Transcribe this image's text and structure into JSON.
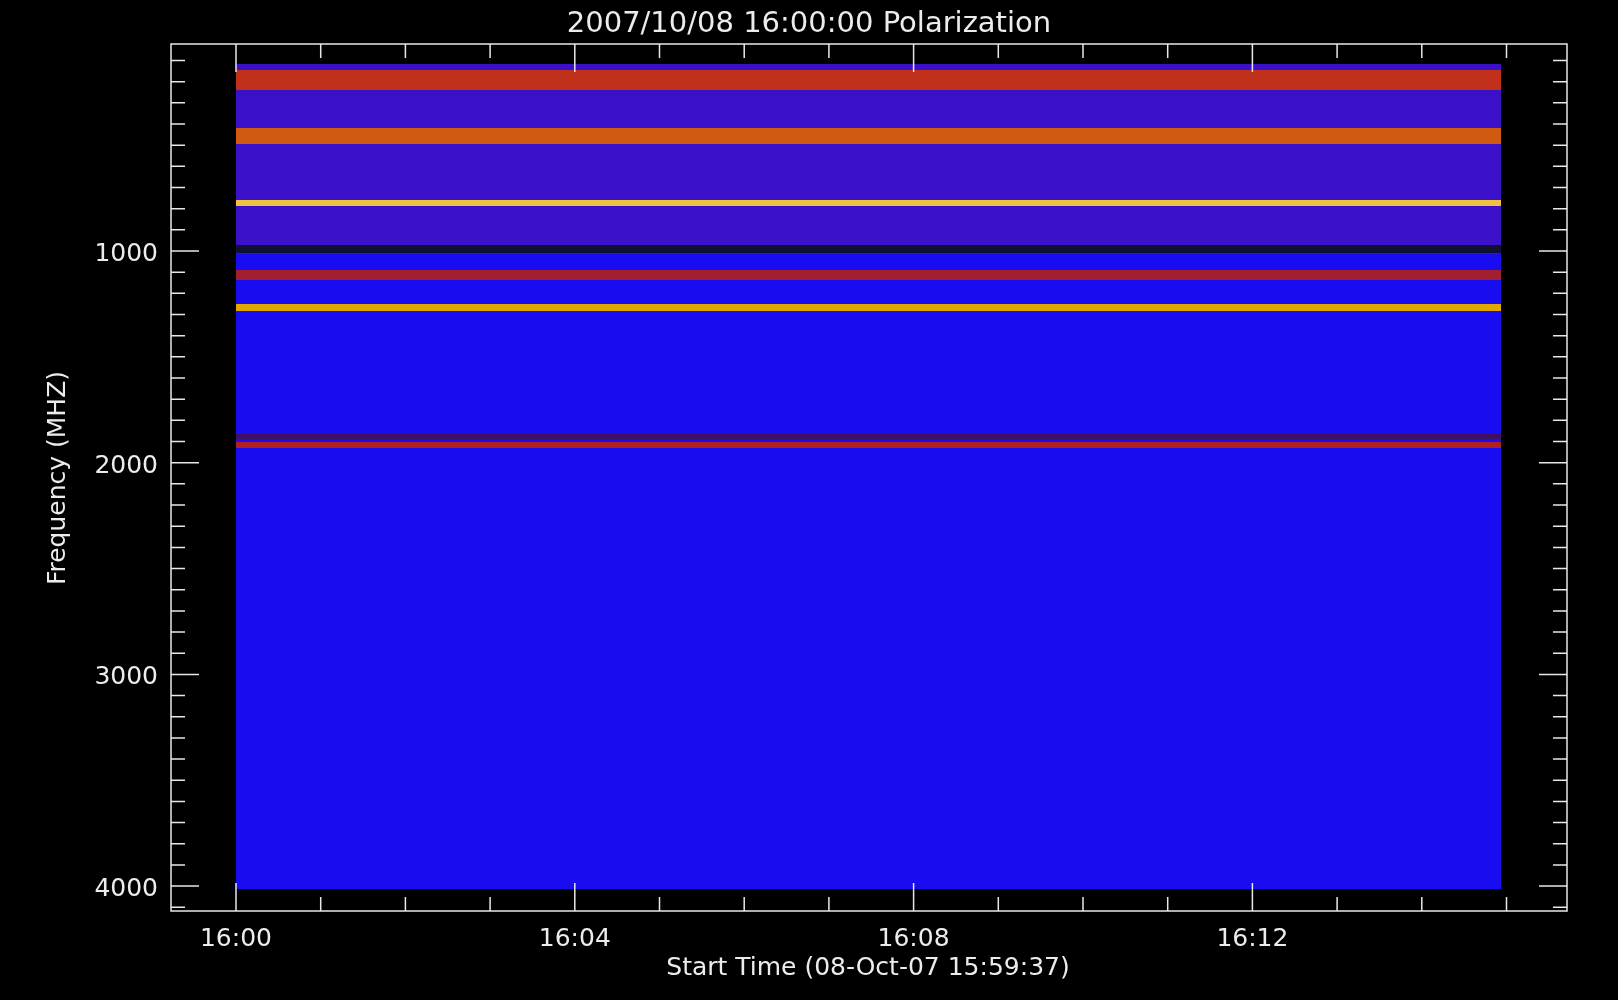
{
  "title": "2007/10/08 16:00:00 Polarization",
  "y_axis": {
    "label": "Frequency (MHZ)",
    "ticks": [
      "1000",
      "2000",
      "3000",
      "4000"
    ]
  },
  "x_axis": {
    "label": "Start Time (08-Oct-07 15:59:37)",
    "ticks": [
      "16:00",
      "16:04",
      "16:08",
      "16:12"
    ]
  }
}
